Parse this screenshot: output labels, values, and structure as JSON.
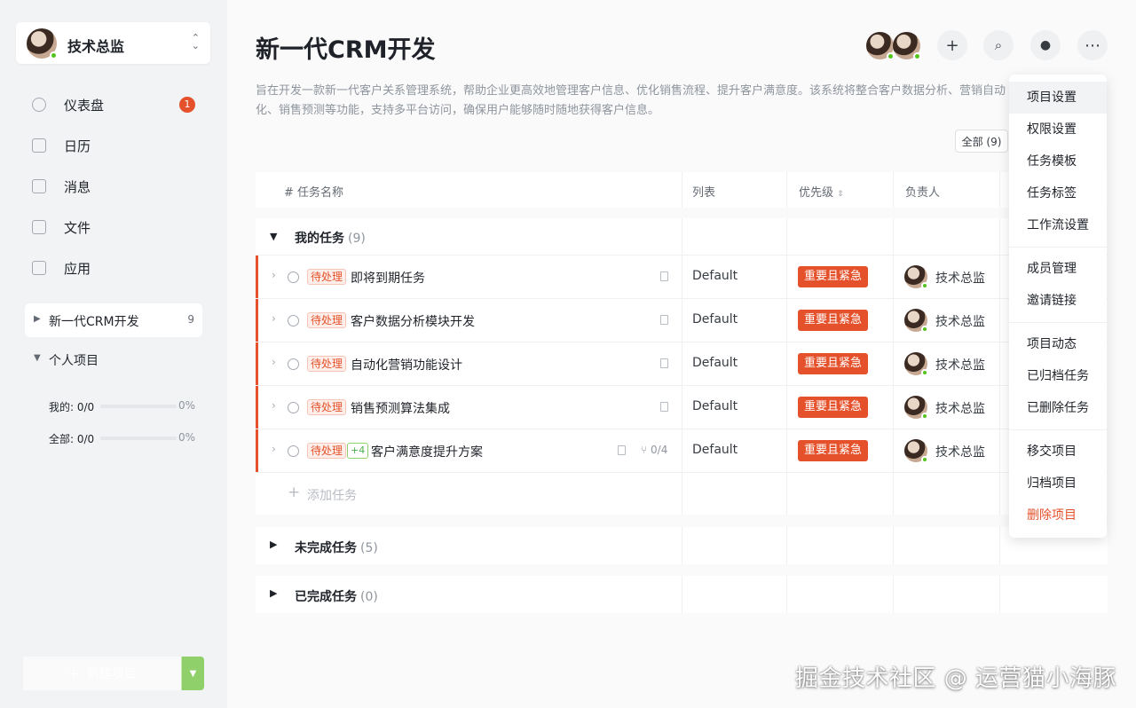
{
  "workspace": {
    "name": "技术总监"
  },
  "nav": [
    {
      "label": "仪表盘",
      "icon": "dashboard-icon",
      "badge": "1"
    },
    {
      "label": "日历",
      "icon": "calendar-icon"
    },
    {
      "label": "消息",
      "icon": "message-icon"
    },
    {
      "label": "文件",
      "icon": "file-icon"
    },
    {
      "label": "应用",
      "icon": "apps-icon"
    }
  ],
  "projects": {
    "active": {
      "name": "新一代CRM开发",
      "count": "9"
    },
    "personal": {
      "name": "个人项目"
    },
    "stats": [
      {
        "label": "我的: 0/0",
        "percent": "0%",
        "progress": 0
      },
      {
        "label": "全部: 0/0",
        "percent": "0%",
        "progress": 0
      }
    ]
  },
  "new_project_label": "新建项目",
  "header": {
    "title": "新一代CRM开发",
    "description": "旨在开发一款新一代客户关系管理系统，帮助企业更高效地管理客户信息、优化销售流程、提升客户满意度。该系统将整合客户数据分析、营销自动化、销售预测等功能，支持多平台访问，确保用户能够随时随地获得客户信息。",
    "filter_label": "全部 (9)"
  },
  "table": {
    "columns": {
      "name": "# 任务名称",
      "list": "列表",
      "priority": "优先级",
      "owner": "负责人"
    },
    "groups": [
      {
        "name": "我的任务",
        "count": "(9)",
        "expanded": true
      },
      {
        "name": "未完成任务",
        "count": "(5)",
        "expanded": false
      },
      {
        "name": "已完成任务",
        "count": "(0)",
        "expanded": false
      }
    ],
    "tasks": [
      {
        "status": "待处理",
        "name": "即将到期任务",
        "list": "Default",
        "priority": "重要且紧急",
        "owner": "技术总监"
      },
      {
        "status": "待处理",
        "name": "客户数据分析模块开发",
        "list": "Default",
        "priority": "重要且紧急",
        "owner": "技术总监"
      },
      {
        "status": "待处理",
        "name": "自动化营销功能设计",
        "list": "Default",
        "priority": "重要且紧急",
        "owner": "技术总监"
      },
      {
        "status": "待处理",
        "name": "销售预测算法集成",
        "list": "Default",
        "priority": "重要且紧急",
        "owner": "技术总监"
      },
      {
        "status": "待处理",
        "extra_tag": "+4",
        "name": "客户满意度提升方案",
        "subtasks": "0/4",
        "list": "Default",
        "priority": "重要且紧急",
        "owner": "技术总监"
      }
    ],
    "add_task_label": "添加任务"
  },
  "menu": {
    "items": [
      "项目设置",
      "权限设置",
      "任务模板",
      "任务标签",
      "工作流设置",
      "成员管理",
      "邀请链接",
      "项目动态",
      "已归档任务",
      "已删除任务",
      "移交项目",
      "归档项目",
      "删除项目"
    ]
  },
  "watermark": "掘金技术社区 @ 运营猫小海豚",
  "colors": {
    "accent": "#e5512b",
    "primary_green": "#8fd06a",
    "online": "#52c41a"
  }
}
